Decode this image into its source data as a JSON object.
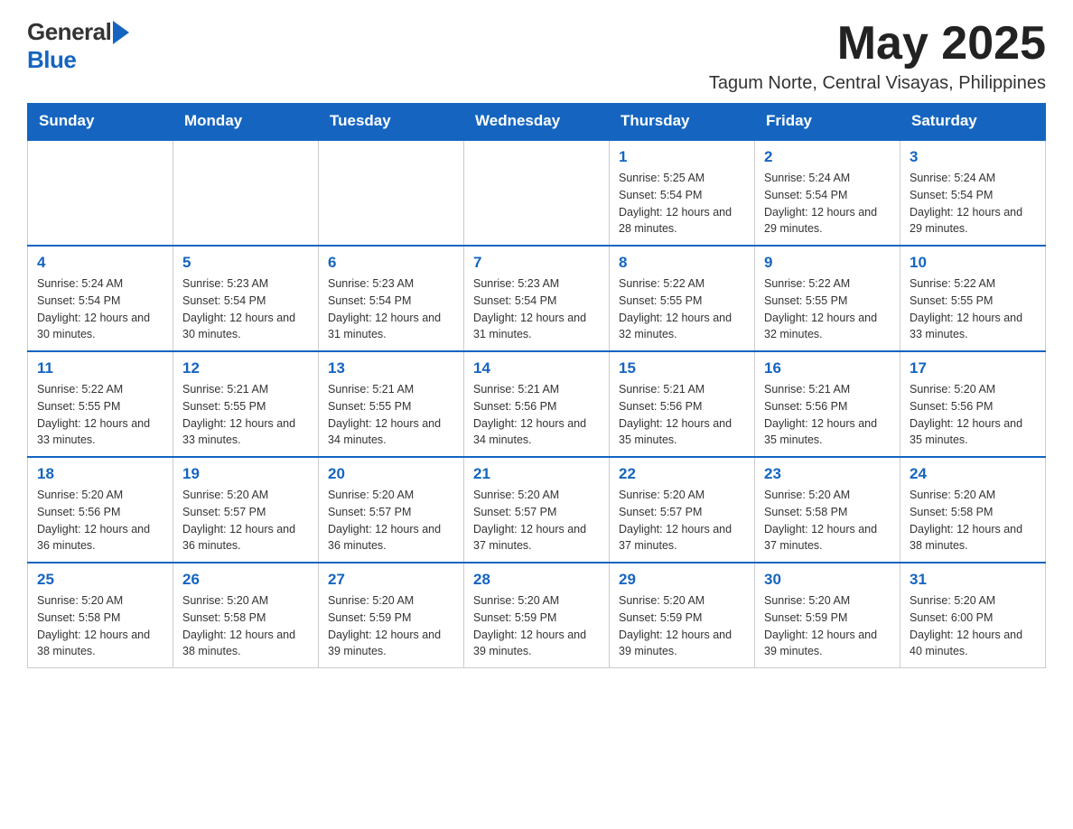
{
  "header": {
    "logo_general": "General",
    "logo_blue": "Blue",
    "month_year": "May 2025",
    "location": "Tagum Norte, Central Visayas, Philippines"
  },
  "calendar": {
    "days_of_week": [
      "Sunday",
      "Monday",
      "Tuesday",
      "Wednesday",
      "Thursday",
      "Friday",
      "Saturday"
    ],
    "weeks": [
      {
        "cells": [
          {
            "day": "",
            "info": ""
          },
          {
            "day": "",
            "info": ""
          },
          {
            "day": "",
            "info": ""
          },
          {
            "day": "",
            "info": ""
          },
          {
            "day": "1",
            "info": "Sunrise: 5:25 AM\nSunset: 5:54 PM\nDaylight: 12 hours and 28 minutes."
          },
          {
            "day": "2",
            "info": "Sunrise: 5:24 AM\nSunset: 5:54 PM\nDaylight: 12 hours and 29 minutes."
          },
          {
            "day": "3",
            "info": "Sunrise: 5:24 AM\nSunset: 5:54 PM\nDaylight: 12 hours and 29 minutes."
          }
        ]
      },
      {
        "cells": [
          {
            "day": "4",
            "info": "Sunrise: 5:24 AM\nSunset: 5:54 PM\nDaylight: 12 hours and 30 minutes."
          },
          {
            "day": "5",
            "info": "Sunrise: 5:23 AM\nSunset: 5:54 PM\nDaylight: 12 hours and 30 minutes."
          },
          {
            "day": "6",
            "info": "Sunrise: 5:23 AM\nSunset: 5:54 PM\nDaylight: 12 hours and 31 minutes."
          },
          {
            "day": "7",
            "info": "Sunrise: 5:23 AM\nSunset: 5:54 PM\nDaylight: 12 hours and 31 minutes."
          },
          {
            "day": "8",
            "info": "Sunrise: 5:22 AM\nSunset: 5:55 PM\nDaylight: 12 hours and 32 minutes."
          },
          {
            "day": "9",
            "info": "Sunrise: 5:22 AM\nSunset: 5:55 PM\nDaylight: 12 hours and 32 minutes."
          },
          {
            "day": "10",
            "info": "Sunrise: 5:22 AM\nSunset: 5:55 PM\nDaylight: 12 hours and 33 minutes."
          }
        ]
      },
      {
        "cells": [
          {
            "day": "11",
            "info": "Sunrise: 5:22 AM\nSunset: 5:55 PM\nDaylight: 12 hours and 33 minutes."
          },
          {
            "day": "12",
            "info": "Sunrise: 5:21 AM\nSunset: 5:55 PM\nDaylight: 12 hours and 33 minutes."
          },
          {
            "day": "13",
            "info": "Sunrise: 5:21 AM\nSunset: 5:55 PM\nDaylight: 12 hours and 34 minutes."
          },
          {
            "day": "14",
            "info": "Sunrise: 5:21 AM\nSunset: 5:56 PM\nDaylight: 12 hours and 34 minutes."
          },
          {
            "day": "15",
            "info": "Sunrise: 5:21 AM\nSunset: 5:56 PM\nDaylight: 12 hours and 35 minutes."
          },
          {
            "day": "16",
            "info": "Sunrise: 5:21 AM\nSunset: 5:56 PM\nDaylight: 12 hours and 35 minutes."
          },
          {
            "day": "17",
            "info": "Sunrise: 5:20 AM\nSunset: 5:56 PM\nDaylight: 12 hours and 35 minutes."
          }
        ]
      },
      {
        "cells": [
          {
            "day": "18",
            "info": "Sunrise: 5:20 AM\nSunset: 5:56 PM\nDaylight: 12 hours and 36 minutes."
          },
          {
            "day": "19",
            "info": "Sunrise: 5:20 AM\nSunset: 5:57 PM\nDaylight: 12 hours and 36 minutes."
          },
          {
            "day": "20",
            "info": "Sunrise: 5:20 AM\nSunset: 5:57 PM\nDaylight: 12 hours and 36 minutes."
          },
          {
            "day": "21",
            "info": "Sunrise: 5:20 AM\nSunset: 5:57 PM\nDaylight: 12 hours and 37 minutes."
          },
          {
            "day": "22",
            "info": "Sunrise: 5:20 AM\nSunset: 5:57 PM\nDaylight: 12 hours and 37 minutes."
          },
          {
            "day": "23",
            "info": "Sunrise: 5:20 AM\nSunset: 5:58 PM\nDaylight: 12 hours and 37 minutes."
          },
          {
            "day": "24",
            "info": "Sunrise: 5:20 AM\nSunset: 5:58 PM\nDaylight: 12 hours and 38 minutes."
          }
        ]
      },
      {
        "cells": [
          {
            "day": "25",
            "info": "Sunrise: 5:20 AM\nSunset: 5:58 PM\nDaylight: 12 hours and 38 minutes."
          },
          {
            "day": "26",
            "info": "Sunrise: 5:20 AM\nSunset: 5:58 PM\nDaylight: 12 hours and 38 minutes."
          },
          {
            "day": "27",
            "info": "Sunrise: 5:20 AM\nSunset: 5:59 PM\nDaylight: 12 hours and 39 minutes."
          },
          {
            "day": "28",
            "info": "Sunrise: 5:20 AM\nSunset: 5:59 PM\nDaylight: 12 hours and 39 minutes."
          },
          {
            "day": "29",
            "info": "Sunrise: 5:20 AM\nSunset: 5:59 PM\nDaylight: 12 hours and 39 minutes."
          },
          {
            "day": "30",
            "info": "Sunrise: 5:20 AM\nSunset: 5:59 PM\nDaylight: 12 hours and 39 minutes."
          },
          {
            "day": "31",
            "info": "Sunrise: 5:20 AM\nSunset: 6:00 PM\nDaylight: 12 hours and 40 minutes."
          }
        ]
      }
    ]
  }
}
